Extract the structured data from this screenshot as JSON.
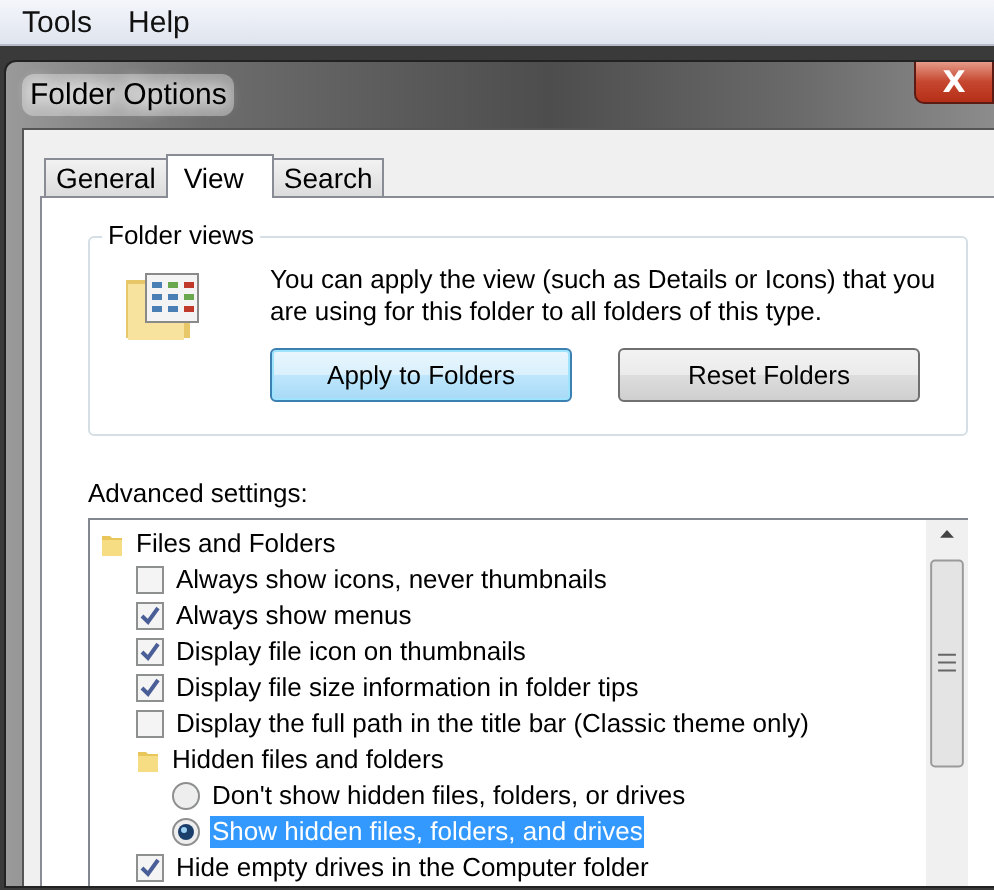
{
  "menu": [
    "Tools",
    "Help"
  ],
  "window": {
    "title": "Folder Options",
    "close": "X"
  },
  "tabs": [
    {
      "label": "General",
      "selected": false
    },
    {
      "label": "View",
      "selected": true
    },
    {
      "label": "Search",
      "selected": false
    }
  ],
  "folder_views": {
    "title": "Folder views",
    "description": "You can apply the view (such as Details or Icons) that you are using for this folder to all folders of this type.",
    "buttons": [
      {
        "label": "Apply to Folders",
        "focused": true
      },
      {
        "label": "Reset Folders",
        "focused": false
      }
    ]
  },
  "advanced": {
    "label": "Advanced settings:",
    "items": [
      {
        "kind": "group",
        "label": "Files and Folders",
        "children": [
          {
            "kind": "checkbox",
            "label": "Always show icons, never thumbnails",
            "checked": false
          },
          {
            "kind": "checkbox",
            "label": "Always show menus",
            "checked": true
          },
          {
            "kind": "checkbox",
            "label": "Display file icon on thumbnails",
            "checked": true
          },
          {
            "kind": "checkbox",
            "label": "Display file size information in folder tips",
            "checked": true
          },
          {
            "kind": "checkbox",
            "label": "Display the full path in the title bar (Classic theme only)",
            "checked": false
          },
          {
            "kind": "group",
            "label": "Hidden files and folders",
            "children": [
              {
                "kind": "radio",
                "label": "Don't show hidden files, folders, or drives",
                "selected": false,
                "highlighted": false
              },
              {
                "kind": "radio",
                "label": "Show hidden files, folders, and drives",
                "selected": true,
                "highlighted": true
              }
            ]
          },
          {
            "kind": "checkbox",
            "label": "Hide empty drives in the Computer folder",
            "checked": true
          }
        ]
      }
    ]
  }
}
